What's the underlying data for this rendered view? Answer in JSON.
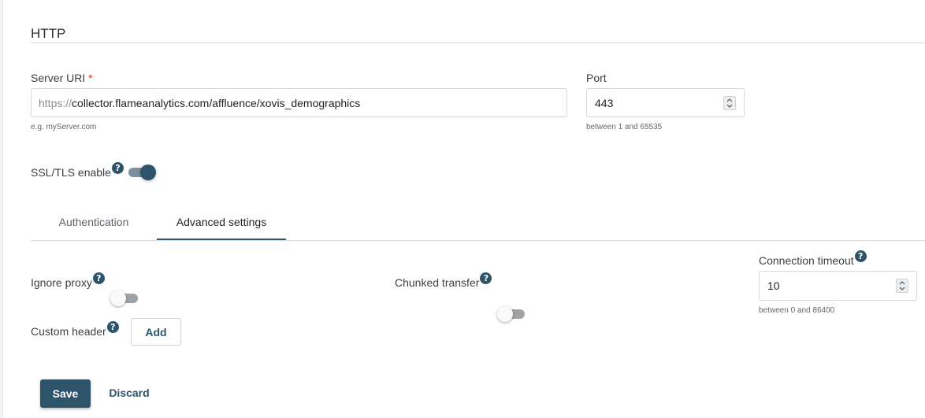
{
  "section": {
    "title": "HTTP"
  },
  "server_uri": {
    "label": "Server URI",
    "required_marker": "*",
    "prefix": "https://",
    "value": "collector.flameanalytics.com/affluence/xovis_demographics",
    "hint": "e.g. myServer.com"
  },
  "port": {
    "label": "Port",
    "value": "443",
    "hint": "between 1 and 65535"
  },
  "ssl": {
    "label": "SSL/TLS enable",
    "help": "?",
    "enabled": true
  },
  "tabs": [
    {
      "label": "Authentication",
      "active": false
    },
    {
      "label": "Advanced settings",
      "active": true
    }
  ],
  "advanced": {
    "ignore_proxy": {
      "label": "Ignore proxy",
      "help": "?",
      "enabled": false
    },
    "chunked_transfer": {
      "label": "Chunked transfer",
      "help": "?",
      "enabled": false
    },
    "connection_timeout": {
      "label": "Connection timeout",
      "help": "?",
      "value": "10",
      "hint": "between 0 and 86400"
    },
    "custom_header": {
      "label": "Custom header",
      "help": "?",
      "add_label": "Add"
    }
  },
  "actions": {
    "save_label": "Save",
    "discard_label": "Discard"
  },
  "colors": {
    "accent": "#2d546b",
    "required": "#d9332b",
    "border": "#d6d9dd"
  }
}
